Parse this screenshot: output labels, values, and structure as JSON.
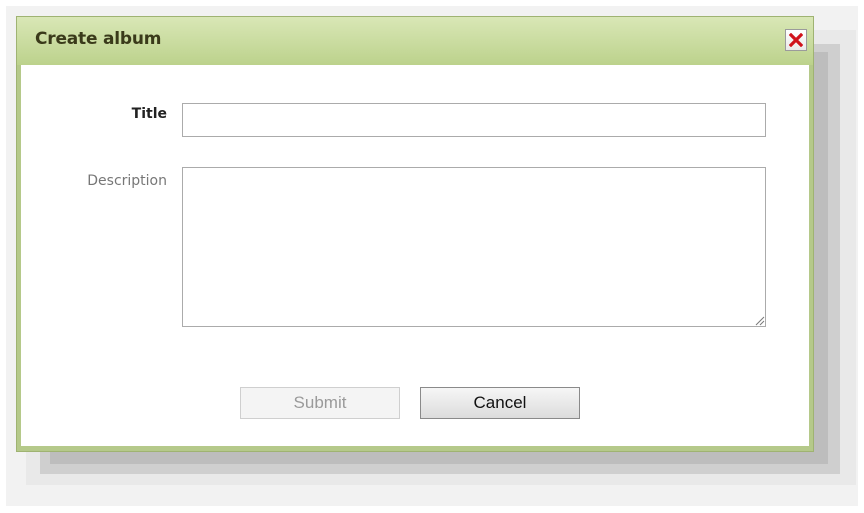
{
  "dialog": {
    "title": "Create album",
    "close_icon": "close-x-icon"
  },
  "form": {
    "title_label": "Title",
    "title_value": "",
    "description_label": "Description",
    "description_value": ""
  },
  "buttons": {
    "submit_label": "Submit",
    "submit_disabled": true,
    "cancel_label": "Cancel"
  },
  "colors": {
    "titlebar": "#bcd28c",
    "close_x": "#d0121b"
  }
}
